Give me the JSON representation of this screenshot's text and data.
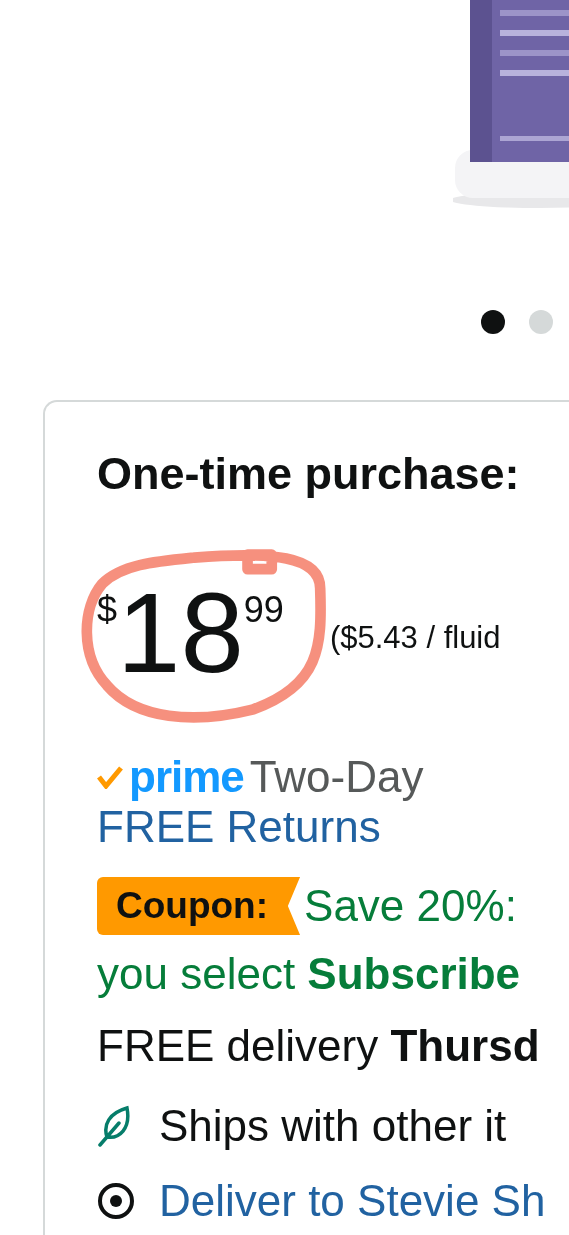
{
  "gallery": {
    "dots": [
      {
        "selected": true
      },
      {
        "selected": false
      }
    ]
  },
  "offer": {
    "heading": "One-time purchase:",
    "price": {
      "symbol": "$",
      "whole": "18",
      "fraction": "99"
    },
    "unit_price": "($5.43 / fluid",
    "prime": {
      "logo": "prime",
      "speed": "Two-Day"
    },
    "returns_link": "FREE Returns",
    "coupon": {
      "badge": "Coupon:",
      "text": "Save 20%:",
      "line2": "you select **Subscribe**"
    },
    "delivery": "FREE delivery **Thursd**",
    "ships_with": "Ships with other it",
    "deliver_to": "Deliver to Stevie Sh"
  }
}
